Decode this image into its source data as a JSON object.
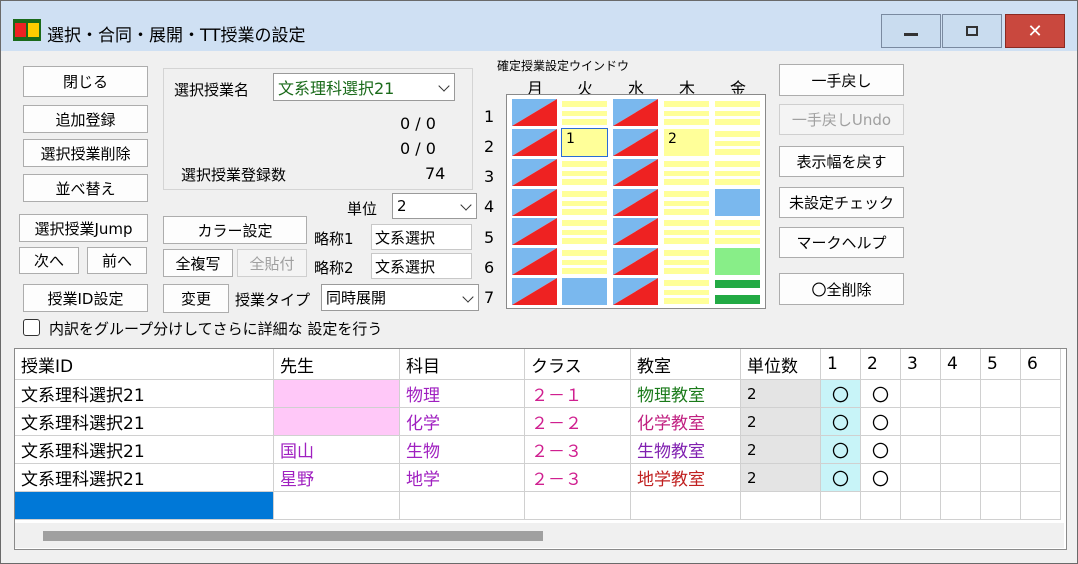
{
  "window": {
    "title": "選択・合同・展開・TT授業の設定",
    "minimize_label": "—",
    "maximize_label": "☐",
    "close_label": "✕"
  },
  "buttons": {
    "close": "閉じる",
    "add": "追加登録",
    "delete": "選択授業削除",
    "sort": "並べ替え",
    "jump": "選択授業Jump",
    "next": "次へ",
    "prev": "前へ",
    "class_id_setting": "授業ID設定",
    "color_setting": "カラー設定",
    "copy_all": "全複写",
    "paste_all": "全貼付",
    "change": "変更",
    "undo": "一手戻し",
    "undo_undo": "一手戻しUndo",
    "restore_width": "表示幅を戻す",
    "unset_check": "未設定チェック",
    "mark_help": "マークヘルプ",
    "delete_all": "〇全削除"
  },
  "form": {
    "class_name_label": "選択授業名",
    "class_name_value": "文系理科選択21",
    "count1": "0 / 0",
    "count2": "0 / 0",
    "registered_label": "選択授業登録数",
    "registered_value": "74",
    "unit_label": "単位",
    "unit_value": "2",
    "abbr1_label": "略称1",
    "abbr1_value": "文系選択",
    "abbr2_label": "略称2",
    "abbr2_value": "文系選択",
    "type_label": "授業タイプ",
    "type_value": "同時展開",
    "detail_checkbox_label": "内訳をグループ分けしてさらに詳細な 設定を行う"
  },
  "schedule": {
    "window_label": "確定授業設定ウインドウ",
    "days": [
      "月",
      "火",
      "水",
      "木",
      "金"
    ],
    "periods": [
      "1",
      "2",
      "3",
      "4",
      "5",
      "6",
      "7"
    ],
    "cell_numbers": {
      "tue_2": "1",
      "thu_2": "2"
    },
    "colors": {
      "red": "#ee2222",
      "blue": "#7ab8ee",
      "yellow": "#ffff99",
      "green": "#88ee88",
      "dark_green": "#22aa44"
    }
  },
  "table": {
    "headers": [
      "授業ID",
      "先生",
      "科目",
      "クラス",
      "教室",
      "単位数",
      "1",
      "2",
      "3",
      "4",
      "5",
      "6"
    ],
    "rows": [
      {
        "id": "文系理科選択21",
        "teacher": "",
        "subject": "物理",
        "class": "２－１",
        "room": "物理教室",
        "units": "2",
        "p1": "〇",
        "p2": "〇"
      },
      {
        "id": "文系理科選択21",
        "teacher": "",
        "subject": "化学",
        "class": "２－２",
        "room": "化学教室",
        "units": "2",
        "p1": "〇",
        "p2": "〇"
      },
      {
        "id": "文系理科選択21",
        "teacher": "国山",
        "subject": "生物",
        "class": "２－３",
        "room": "生物教室",
        "units": "2",
        "p1": "〇",
        "p2": "〇"
      },
      {
        "id": "文系理科選択21",
        "teacher": "星野",
        "subject": "地学",
        "class": "２－３",
        "room": "地学教室",
        "units": "2",
        "p1": "〇",
        "p2": "〇"
      }
    ],
    "colors": {
      "subject": "#a020c0",
      "class": "#d02090",
      "room_physics": "#1a7a1a",
      "room_chem": "#c02080",
      "room_bio": "#8020b0",
      "room_geo": "#c02020",
      "teacher": "#a020c0",
      "teacher_empty_bg": "#ffc8f8",
      "circle_bg": "#c8f4f8",
      "units_bg": "#e4e4e4",
      "selected_bg": "#0078d7"
    }
  }
}
